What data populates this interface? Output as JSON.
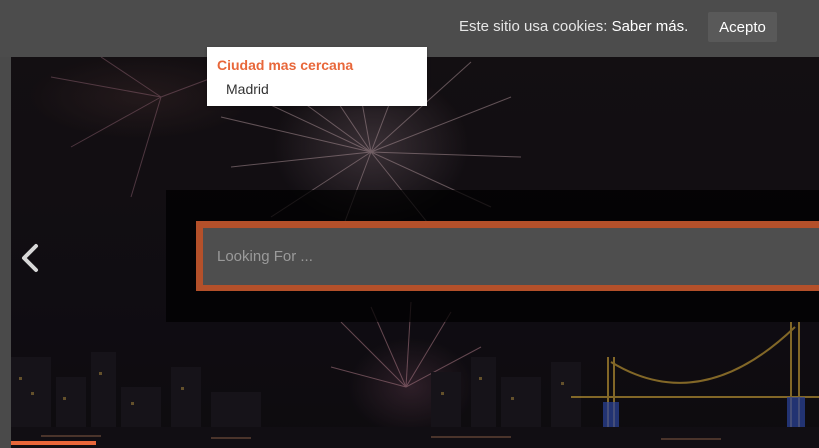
{
  "cookie_bar": {
    "text": "Este sitio usa cookies:",
    "link_label": "Saber más.",
    "accept_label": "Acepto"
  },
  "city_popup": {
    "title": "Ciudad mas cercana",
    "items": [
      "Madrid"
    ]
  },
  "search": {
    "placeholder": "Looking For ..."
  },
  "hero": {
    "image": "fireworks-city-night"
  },
  "colors": {
    "accent": "#e8673a",
    "topbar": "#4c4c4c",
    "search_border": "#b4502a"
  },
  "icons": {
    "prev": "chevron-left-icon"
  }
}
